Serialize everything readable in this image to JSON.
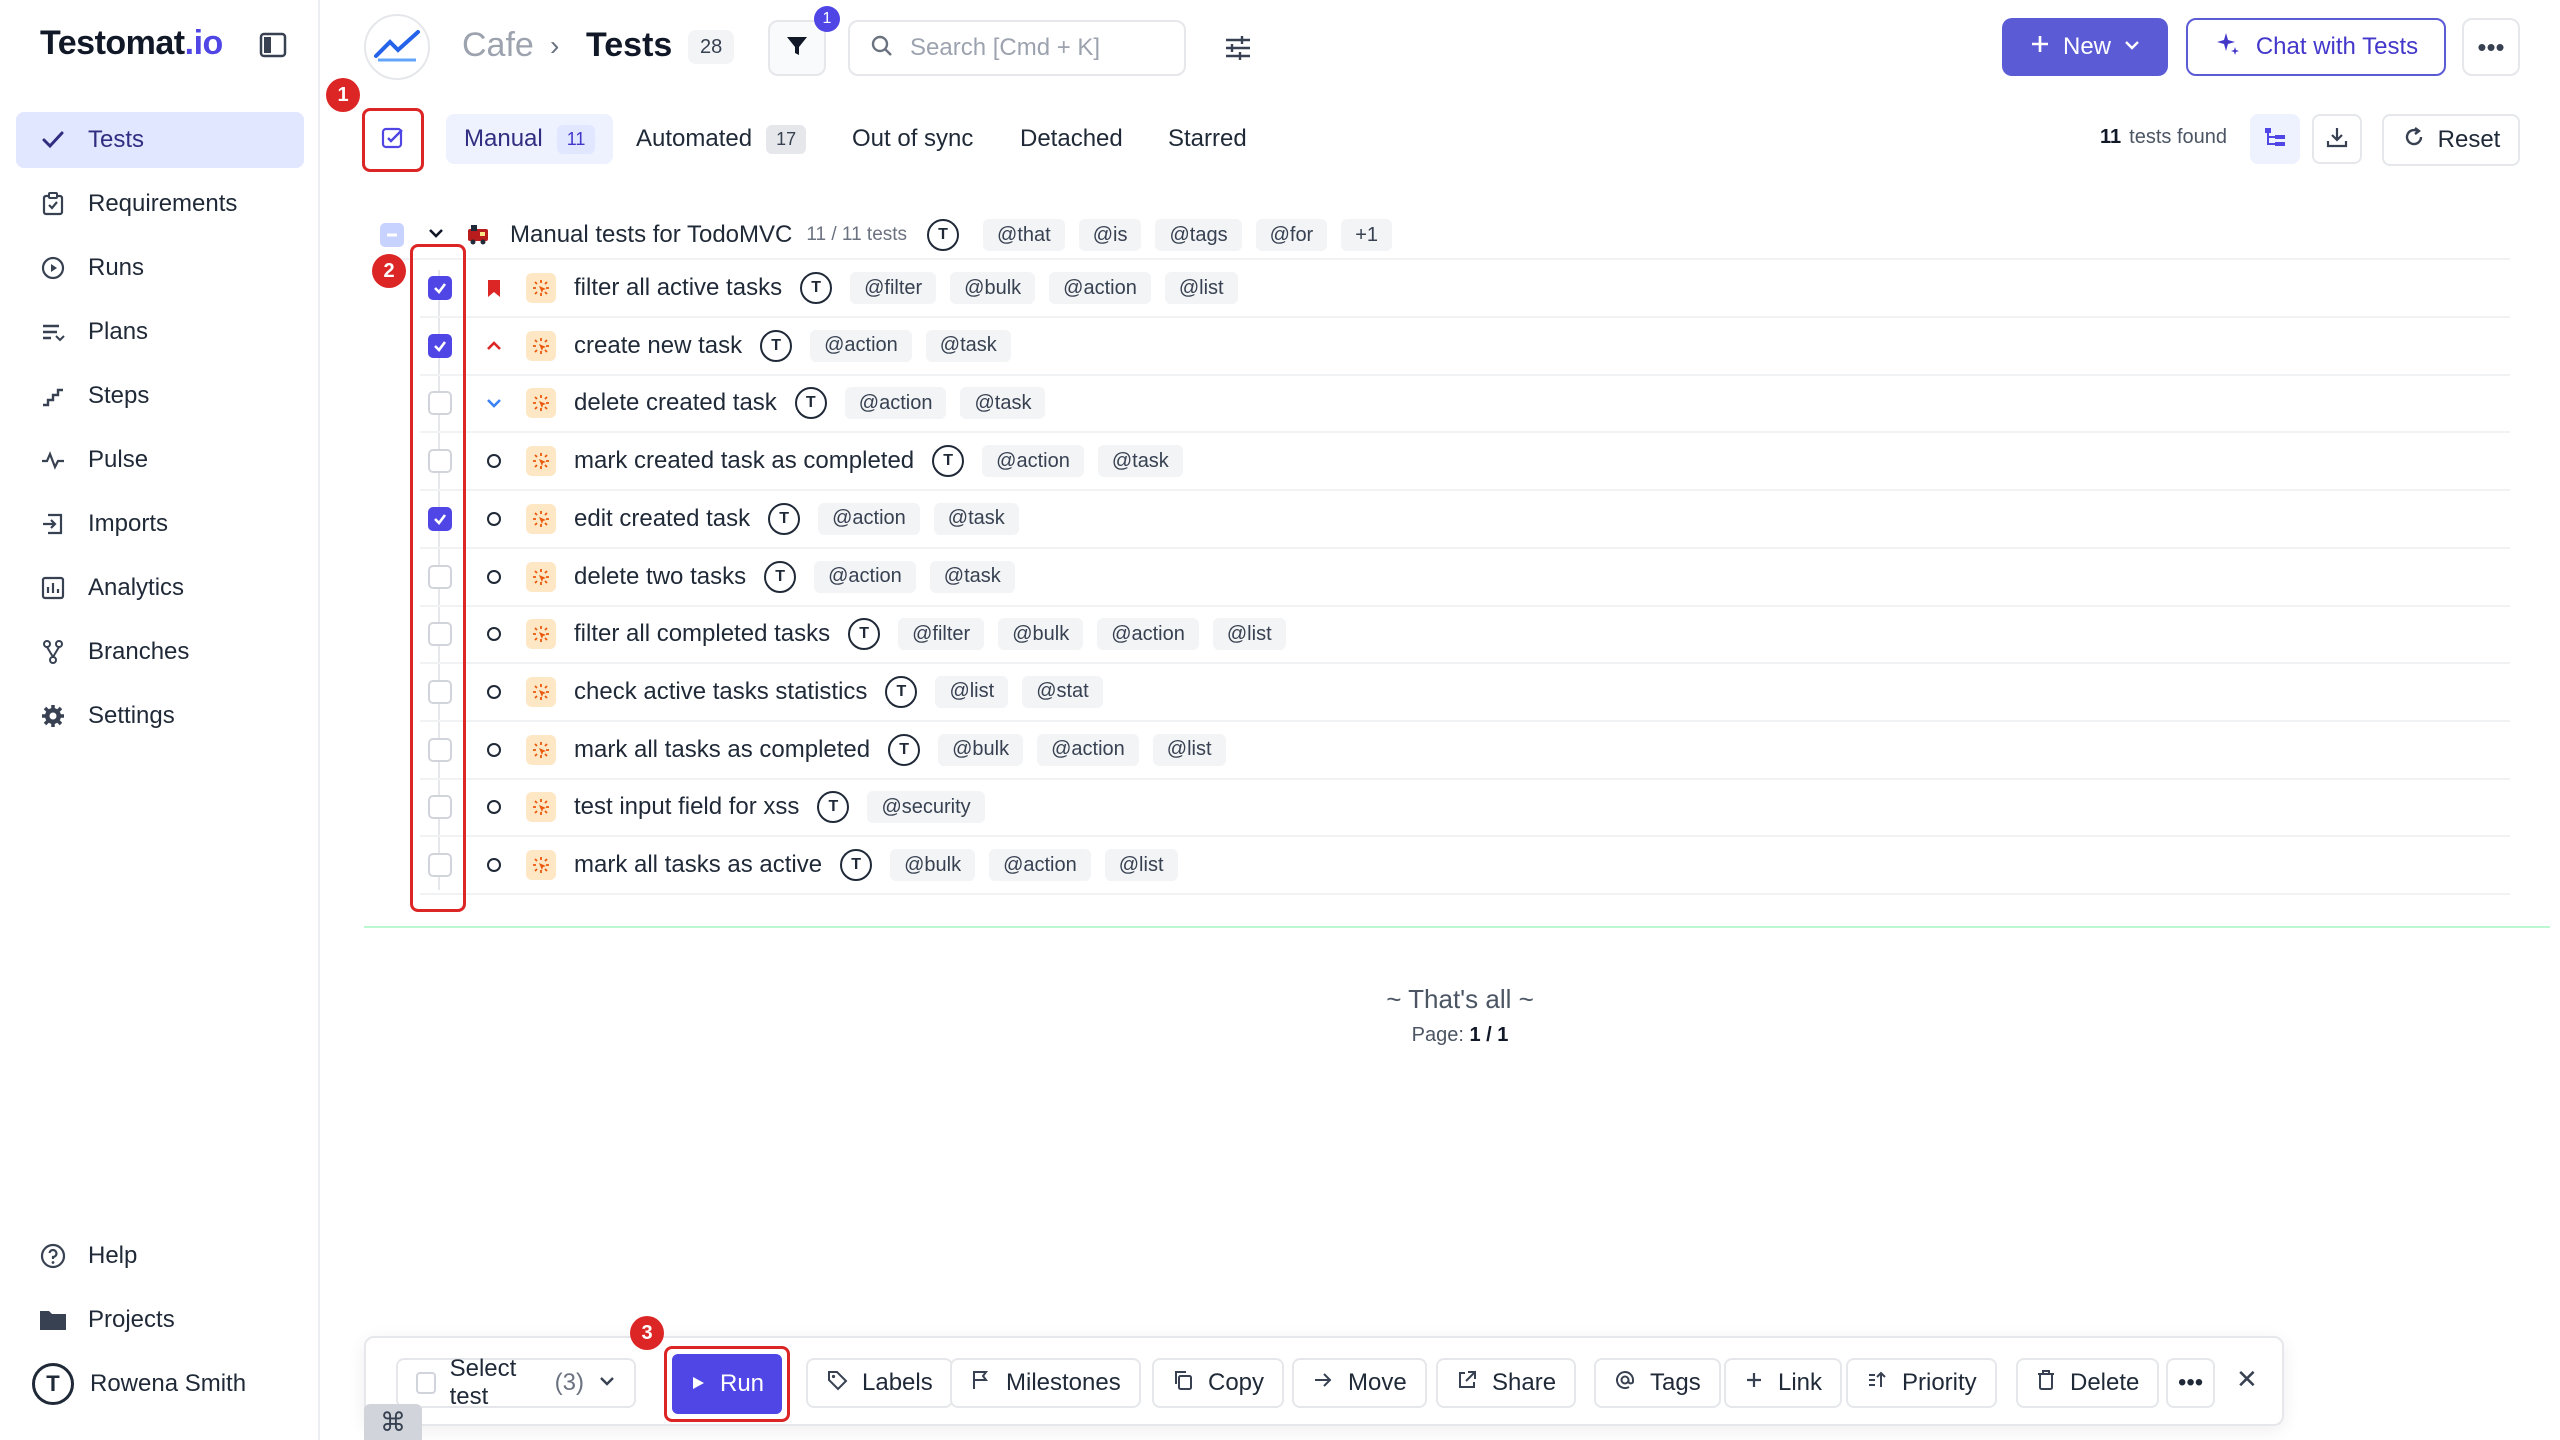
{
  "app": {
    "logo_text": "Testomat",
    "logo_suffix": ".io"
  },
  "sidebar": {
    "items": [
      {
        "label": "Tests",
        "icon": "check-icon",
        "active": true
      },
      {
        "label": "Requirements",
        "icon": "clipboard-check-icon"
      },
      {
        "label": "Runs",
        "icon": "play-circle-icon"
      },
      {
        "label": "Plans",
        "icon": "list-icon"
      },
      {
        "label": "Steps",
        "icon": "steps-icon"
      },
      {
        "label": "Pulse",
        "icon": "pulse-icon"
      },
      {
        "label": "Imports",
        "icon": "import-icon"
      },
      {
        "label": "Analytics",
        "icon": "bar-chart-icon"
      },
      {
        "label": "Branches",
        "icon": "branch-icon"
      },
      {
        "label": "Settings",
        "icon": "gear-icon"
      }
    ],
    "help_label": "Help",
    "projects_label": "Projects",
    "user_name": "Rowena Smith"
  },
  "header": {
    "project": "Cafe",
    "separator": "›",
    "page_title": "Tests",
    "test_count": "28",
    "filter_count": "1",
    "search_placeholder": "Search [Cmd + K]",
    "new_label": "New",
    "chat_label": "Chat with Tests",
    "more_label": "•••"
  },
  "tabs": [
    {
      "label": "Manual",
      "count": "11",
      "active": true
    },
    {
      "label": "Automated",
      "count": "17"
    },
    {
      "label": "Out of sync"
    },
    {
      "label": "Detached"
    },
    {
      "label": "Starred"
    }
  ],
  "results": {
    "count": "11",
    "label": "tests found",
    "reset_label": "Reset"
  },
  "suite": {
    "name": "Manual tests for TodoMVC",
    "counter": "11 / 11 tests",
    "avatar": "T",
    "tags": [
      "@that",
      "@is",
      "@tags",
      "@for",
      "+1"
    ]
  },
  "tests": [
    {
      "name": "filter all active tasks",
      "checked": true,
      "priority": "bookmark",
      "tags": [
        "@filter",
        "@bulk",
        "@action",
        "@list"
      ]
    },
    {
      "name": "create new task",
      "checked": true,
      "priority": "high",
      "tags": [
        "@action",
        "@task"
      ]
    },
    {
      "name": "delete created task",
      "checked": false,
      "priority": "low",
      "tags": [
        "@action",
        "@task"
      ]
    },
    {
      "name": "mark created task as completed",
      "checked": false,
      "priority": "normal",
      "tags": [
        "@action",
        "@task"
      ]
    },
    {
      "name": "edit created task",
      "checked": true,
      "priority": "normal",
      "tags": [
        "@action",
        "@task"
      ]
    },
    {
      "name": "delete two tasks",
      "checked": false,
      "priority": "normal",
      "tags": [
        "@action",
        "@task"
      ]
    },
    {
      "name": "filter all completed tasks",
      "checked": false,
      "priority": "normal",
      "tags": [
        "@filter",
        "@bulk",
        "@action",
        "@list"
      ]
    },
    {
      "name": "check active tasks statistics",
      "checked": false,
      "priority": "normal",
      "tags": [
        "@list",
        "@stat"
      ]
    },
    {
      "name": "mark all tasks as completed",
      "checked": false,
      "priority": "normal",
      "tags": [
        "@bulk",
        "@action",
        "@list"
      ]
    },
    {
      "name": "test input field for xss",
      "checked": false,
      "priority": "normal",
      "tags": [
        "@security"
      ]
    },
    {
      "name": "mark all tasks as active",
      "checked": false,
      "priority": "normal",
      "tags": [
        "@bulk",
        "@action",
        "@list"
      ]
    }
  ],
  "footer": {
    "thats_all": "~ That's all ~",
    "page_label": "Page:",
    "page_value": "1 / 1"
  },
  "bulk_bar": {
    "select_label": "Select test",
    "select_count": "(3)",
    "run_label": "Run",
    "labels_label": "Labels",
    "milestones_label": "Milestones",
    "copy_label": "Copy",
    "move_label": "Move",
    "share_label": "Share",
    "tags_label": "Tags",
    "link_label": "Link",
    "priority_label": "Priority",
    "delete_label": "Delete",
    "more_label": "•••",
    "close_label": "✕"
  },
  "callouts": [
    "1",
    "2",
    "3"
  ],
  "cmd_key": "⌘",
  "colors": {
    "accent": "#4f46e5",
    "callout_red": "#dc2626",
    "manual_icon_bg": "#fde7c4",
    "active_nav_bg": "#e0e7ff"
  }
}
